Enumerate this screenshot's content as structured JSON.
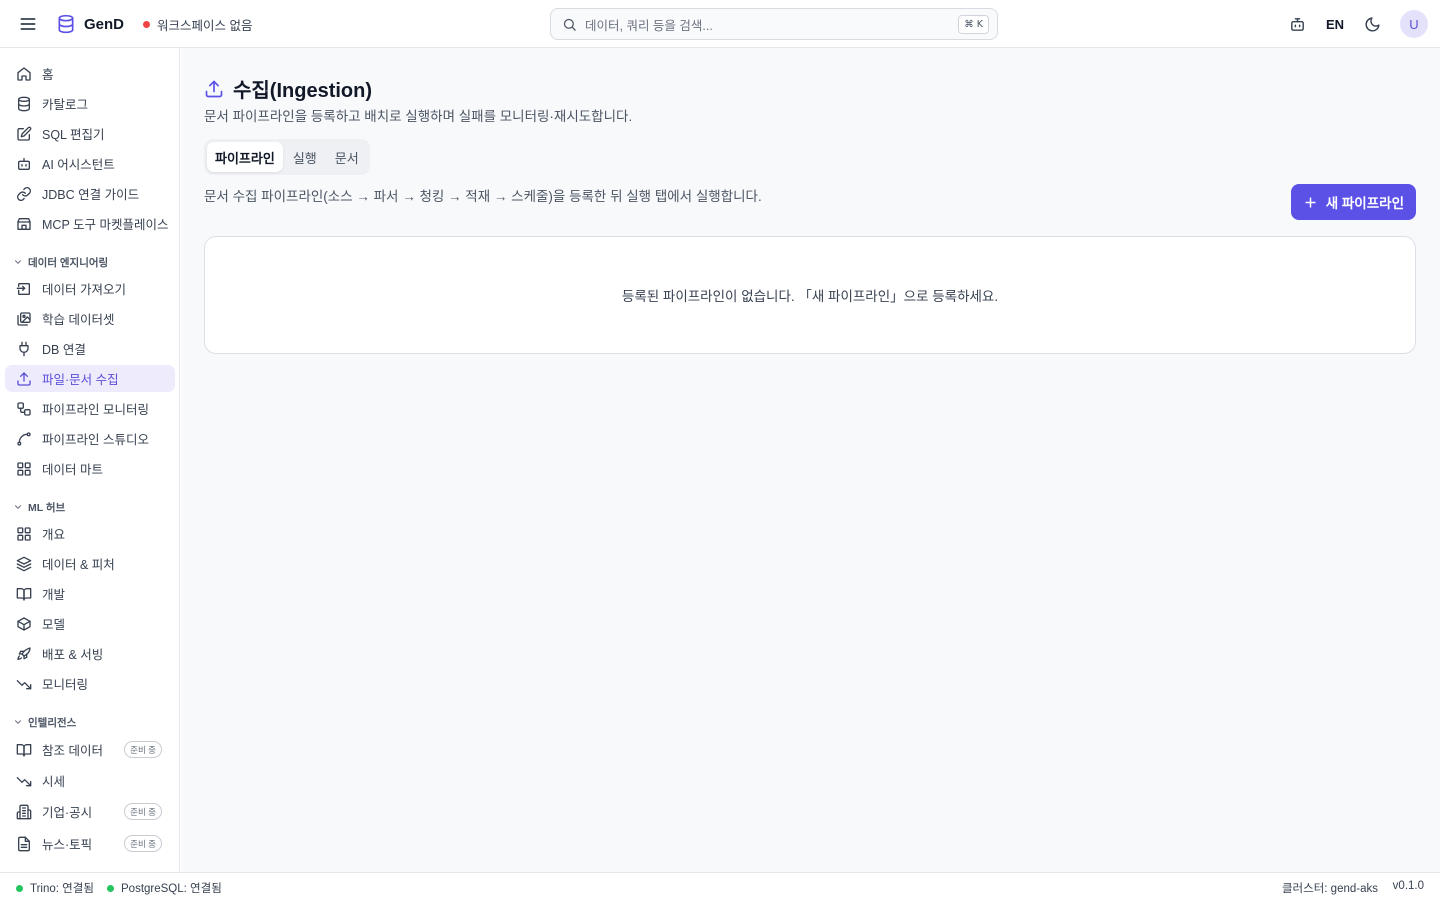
{
  "app": {
    "name": "GenD"
  },
  "header": {
    "workspace_status": "워크스페이스 없음",
    "workspace_dot_color": "#ef4444",
    "search_placeholder": "데이터, 쿼리 등을 검색...",
    "search_shortcut": "⌘ K",
    "language": "EN",
    "avatar_initial": "U",
    "icons": [
      "menu-icon",
      "database-logo-icon",
      "search-icon",
      "bot-icon",
      "moon-icon"
    ]
  },
  "sidebar": {
    "items": [
      {
        "label": "홈",
        "icon": "home-icon"
      },
      {
        "label": "카탈로그",
        "icon": "database-icon"
      },
      {
        "label": "SQL 편집기",
        "icon": "edit-icon"
      },
      {
        "label": "AI 어시스턴트",
        "icon": "bot-icon"
      },
      {
        "label": "JDBC 연결 가이드",
        "icon": "link-icon"
      },
      {
        "label": "MCP 도구 마켓플레이스",
        "icon": "store-icon"
      }
    ],
    "sections": [
      {
        "title": "데이터 엔지니어링",
        "items": [
          {
            "label": "데이터 가져오기",
            "icon": "import-icon"
          },
          {
            "label": "학습 데이터셋",
            "icon": "images-icon"
          },
          {
            "label": "DB 연결",
            "icon": "plug-icon"
          },
          {
            "label": "파일·문서 수집",
            "icon": "upload-icon",
            "active": true
          },
          {
            "label": "파이프라인 모니터링",
            "icon": "workflow-icon"
          },
          {
            "label": "파이프라인 스튜디오",
            "icon": "spline-icon"
          },
          {
            "label": "데이터 마트",
            "icon": "grid-icon"
          }
        ]
      },
      {
        "title": "ML 허브",
        "items": [
          {
            "label": "개요",
            "icon": "grid-icon"
          },
          {
            "label": "데이터 & 피처",
            "icon": "layers-icon"
          },
          {
            "label": "개발",
            "icon": "book-icon"
          },
          {
            "label": "모델",
            "icon": "box-icon"
          },
          {
            "label": "배포 & 서빙",
            "icon": "rocket-icon"
          },
          {
            "label": "모니터링",
            "icon": "trend-down-icon"
          }
        ]
      },
      {
        "title": "인텔리전스",
        "items": [
          {
            "label": "참조 데이터",
            "icon": "book-icon",
            "badge": "준비 중"
          },
          {
            "label": "시세",
            "icon": "trend-down-icon"
          },
          {
            "label": "기업·공시",
            "icon": "building-icon",
            "badge": "준비 중"
          },
          {
            "label": "뉴스·토픽",
            "icon": "file-text-icon",
            "badge": "준비 중"
          }
        ]
      }
    ]
  },
  "page": {
    "title": "수집(Ingestion)",
    "subtitle": "문서 파이프라인을 등록하고 배치로 실행하며 실패를 모니터링·재시도합니다.",
    "tabs": [
      {
        "label": "파이프라인",
        "active": true
      },
      {
        "label": "실행",
        "active": false
      },
      {
        "label": "문서",
        "active": false
      }
    ],
    "description": "문서 수집 파이프라인(소스 → 파서 → 청킹 → 적재 → 스케줄)을 등록한 뒤 실행 탭에서 실행합니다.",
    "new_button_label": "새 파이프라인",
    "empty_message": "등록된 파이프라인이 없습니다. 「새 파이프라인」으로 등록하세요.",
    "accent_color": "#5b51e6"
  },
  "statusbar": {
    "trino": "Trino: 연결됨",
    "postgres": "PostgreSQL: 연결됨",
    "connected_color": "#22c55e",
    "cluster": "클러스터: gend-aks",
    "version": "v0.1.0"
  }
}
